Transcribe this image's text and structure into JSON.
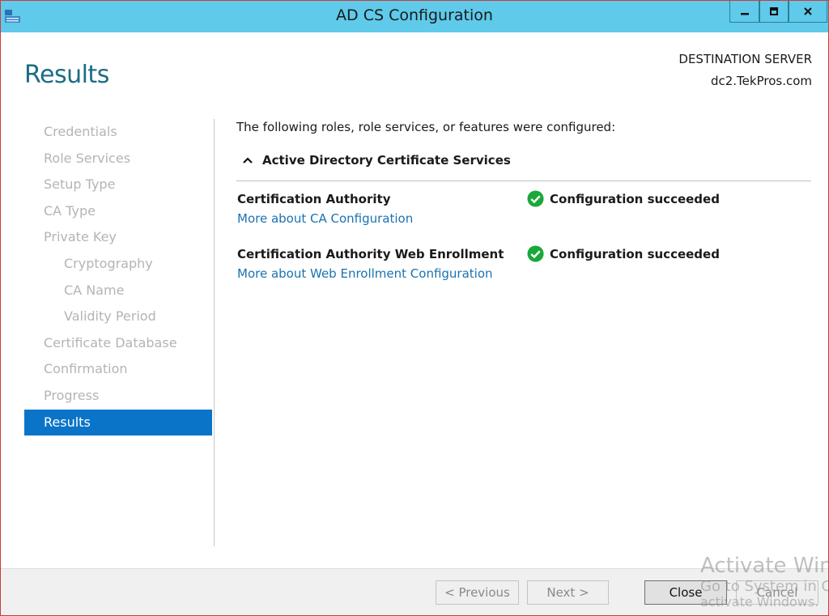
{
  "window": {
    "title": "AD CS Configuration",
    "controls": {
      "minimize": "–",
      "maximize": "□",
      "close": "x"
    }
  },
  "header": {
    "page_title": "Results",
    "destination_label": "DESTINATION SERVER",
    "destination_server": "dc2.TekPros.com"
  },
  "nav": {
    "items": [
      {
        "label": "Credentials"
      },
      {
        "label": "Role Services"
      },
      {
        "label": "Setup Type"
      },
      {
        "label": "CA Type"
      },
      {
        "label": "Private Key"
      },
      {
        "label": "Cryptography"
      },
      {
        "label": "CA Name"
      },
      {
        "label": "Validity Period"
      },
      {
        "label": "Certificate Database"
      },
      {
        "label": "Confirmation"
      },
      {
        "label": "Progress"
      },
      {
        "label": "Results"
      }
    ]
  },
  "main": {
    "intro": "The following roles, role services, or features were configured:",
    "section_title": "Active Directory Certificate Services",
    "roles": [
      {
        "name": "Certification Authority",
        "link": "More about CA Configuration",
        "status": "Configuration succeeded"
      },
      {
        "name": "Certification Authority Web Enrollment",
        "link": "More about Web Enrollment Configuration",
        "status": "Configuration succeeded"
      }
    ]
  },
  "footer": {
    "previous": "< Previous",
    "next": "Next >",
    "close": "Close",
    "cancel": "Cancel"
  },
  "watermark": {
    "line1": "Activate Windows",
    "line2": "Go to System in Control Panel to",
    "line3": "activate Windows."
  },
  "colors": {
    "titlebar": "#5fcaea",
    "accent": "#0a74c8",
    "title_text": "#1b6d84",
    "link": "#1a72b0",
    "success": "#19a83a"
  }
}
